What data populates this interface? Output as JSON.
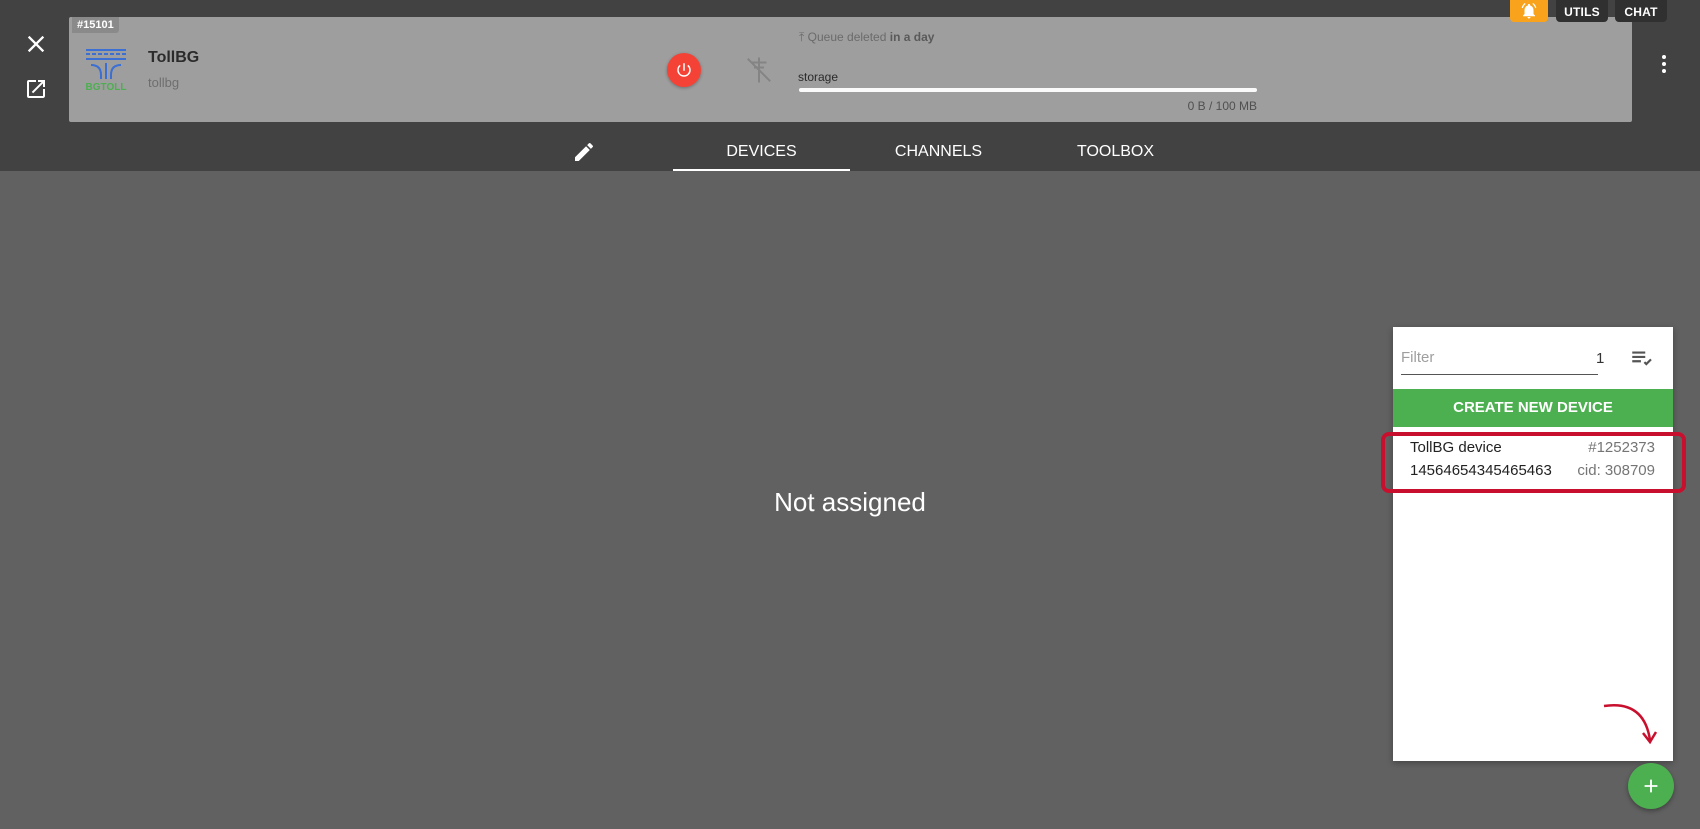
{
  "app": {
    "id": "#15101",
    "name": "TollBG",
    "slug": "tollbg",
    "logo_text": "BGTOLL",
    "queue_prefix": "Queue deleted",
    "queue_when": "in a day",
    "storage_label": "storage",
    "storage_size": "0 B / 100 MB",
    "storage_used_fraction": 0
  },
  "top_chips": {
    "utils": "UTILS",
    "chat": "CHAT"
  },
  "tabs": [
    {
      "label": "DEVICES",
      "active": true
    },
    {
      "label": "CHANNELS",
      "active": false
    },
    {
      "label": "TOOLBOX",
      "active": false
    }
  ],
  "main": {
    "message": "Not assigned"
  },
  "devices_panel": {
    "filter_placeholder": "Filter",
    "count": "1",
    "create_label": "CREATE NEW DEVICE",
    "items": [
      {
        "name": "TollBG device",
        "serial": "14564654345465463",
        "id": "#1252373",
        "cid": "cid: 308709"
      }
    ]
  },
  "colors": {
    "accent_green": "#4caf50",
    "power_red": "#f44336",
    "bell_orange": "#f9a21b",
    "annotation_red": "#c8102e"
  },
  "icons": [
    "close-icon",
    "open-in-new-icon",
    "power-icon",
    "antenna-off-icon",
    "upload-icon",
    "more-vert-icon",
    "bell-icon",
    "edit-icon",
    "playlist-check-icon",
    "add-icon"
  ]
}
